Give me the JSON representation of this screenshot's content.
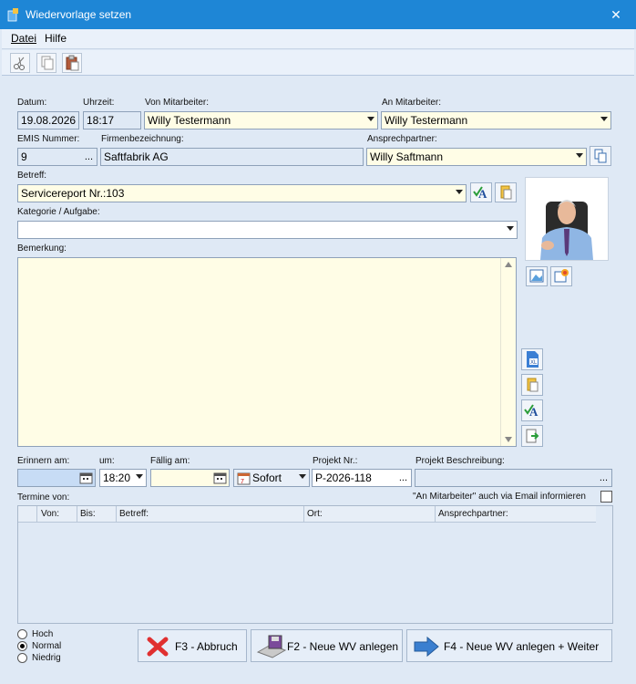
{
  "window": {
    "title": "Wiedervorlage setzen",
    "close_symbol": "✕"
  },
  "menu": {
    "file": "Datei",
    "help": "Hilfe"
  },
  "form": {
    "date_label": "Datum:",
    "date_value": "19.08.2026",
    "time_label": "Uhrzeit:",
    "time_value": "18:17",
    "from_employee_label": "Von Mitarbeiter:",
    "from_employee_value": "Willy Testermann",
    "to_employee_label": "An Mitarbeiter:",
    "to_employee_value": "Willy Testermann",
    "emis_label": "EMIS Nummer:",
    "emis_value": "9",
    "company_label": "Firmenbezeichnung:",
    "company_value": "Saftfabrik AG",
    "contact_label": "Ansprechpartner:",
    "contact_value": "Willy Saftmann",
    "subject_label": "Betreff:",
    "subject_value": "Servicereport Nr.:103",
    "category_label": "Kategorie / Aufgabe:",
    "category_value": "",
    "remark_label": "Bemerkung:",
    "remark_value": "",
    "remind_label": "Erinnern am:",
    "remind_value": "",
    "at_label": "um:",
    "at_value": "18:20",
    "due_label": "Fällig am:",
    "due_value": "",
    "sofort_label": "Sofort",
    "project_no_label": "Projekt Nr.:",
    "project_no_value": "P-2026-118",
    "project_desc_label": "Projekt Beschreibung:",
    "project_desc_value": "",
    "appointments_label": "Termine von:",
    "email_notify_label": "\"An Mitarbeiter\" auch via Email informieren",
    "ellipsis": "..."
  },
  "appointments_table": {
    "columns": [
      "Von:",
      "Bis:",
      "Betreff:",
      "Ort:",
      "Ansprechpartner:"
    ],
    "rows": []
  },
  "priority": {
    "options": [
      "Hoch",
      "Normal",
      "Niedrig"
    ],
    "selected": "Normal"
  },
  "buttons": {
    "cancel": "F3 - Abbruch",
    "new_wv": "F2 - Neue WV anlegen",
    "new_wv_continue": "F4 - Neue WV anlegen + Weiter"
  },
  "colors": {
    "titlebar": "#1e86d6",
    "window_bg": "#dfe9f5",
    "input_yellow": "#fffde6"
  }
}
